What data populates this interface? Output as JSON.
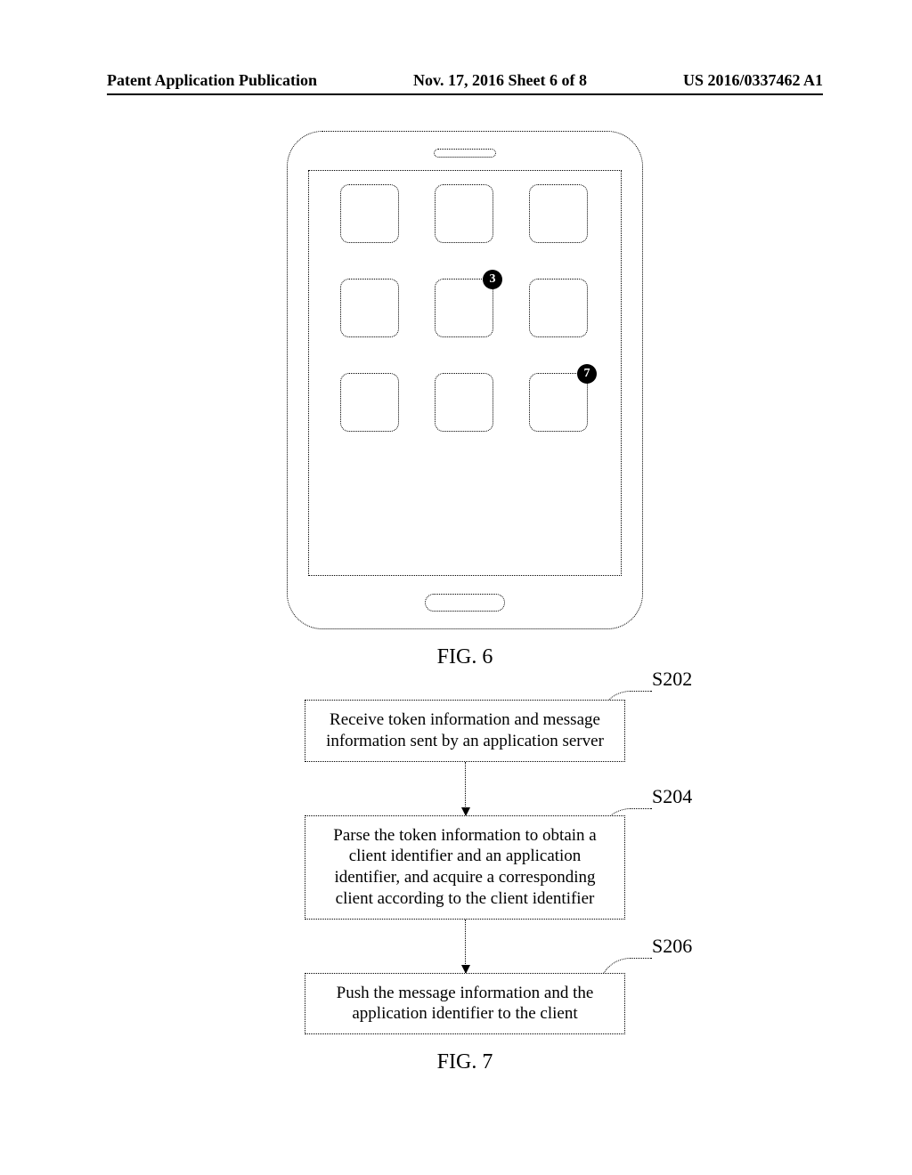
{
  "header": {
    "left": "Patent Application Publication",
    "center": "Nov. 17, 2016  Sheet 6 of 8",
    "right": "US 2016/0337462 A1"
  },
  "fig6": {
    "caption": "FIG. 6",
    "badges": {
      "icon5": "3",
      "icon9": "7"
    }
  },
  "fig7": {
    "caption": "FIG. 7",
    "steps": [
      {
        "label": "S202",
        "text": "Receive token information and message information sent by an application server"
      },
      {
        "label": "S204",
        "text": "Parse the token information to obtain a client identifier and an application identifier, and acquire a corresponding client according to the client identifier"
      },
      {
        "label": "S206",
        "text": "Push the message information and the application identifier to the client"
      }
    ]
  }
}
